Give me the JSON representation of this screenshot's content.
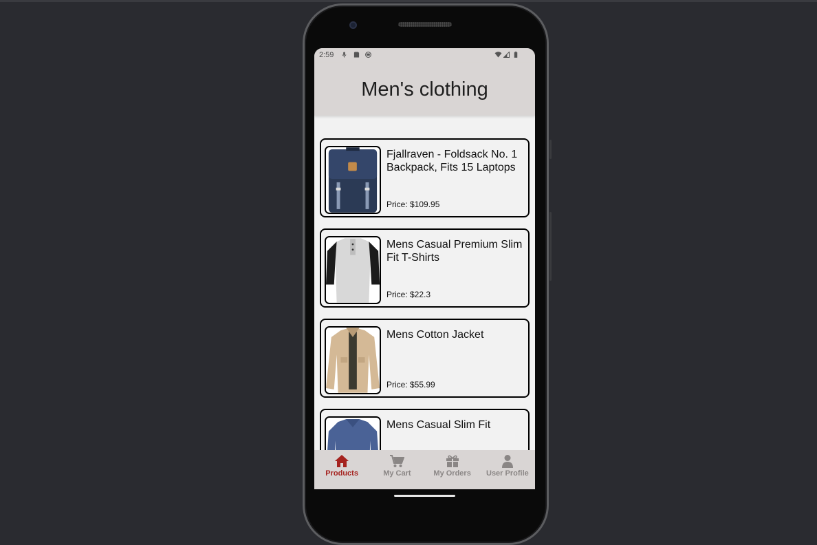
{
  "status_bar": {
    "time": "2:59"
  },
  "header": {
    "title": "Men's clothing"
  },
  "products": [
    {
      "title": "Fjallraven - Foldsack No. 1 Backpack, Fits 15 Laptops",
      "price": "Price: $109.95",
      "image": "backpack"
    },
    {
      "title": "Mens Casual Premium Slim Fit T-Shirts",
      "price": "Price: $22.3",
      "image": "t-shirt"
    },
    {
      "title": "Mens Cotton Jacket",
      "price": "Price: $55.99",
      "image": "jacket"
    },
    {
      "title": "Mens Casual Slim Fit",
      "price": "",
      "image": "long-sleeve-shirt"
    }
  ],
  "nav": {
    "products": "Products",
    "cart": "My Cart",
    "orders": "My Orders",
    "profile": "User Profile"
  },
  "colors": {
    "active_nav": "#a5231f",
    "inactive_nav": "#8a8685",
    "header_bg": "#d9d5d4"
  }
}
